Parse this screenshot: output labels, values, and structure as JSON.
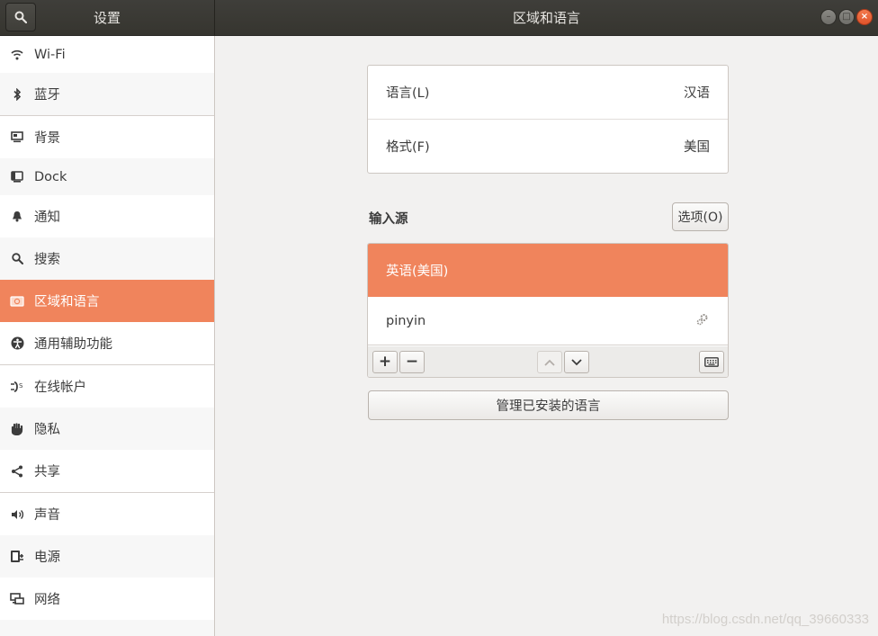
{
  "header": {
    "sidebar_title": "设置",
    "title": "区域和语言",
    "buttons": {
      "minimize": "–",
      "maximize": "□",
      "close": "×"
    }
  },
  "sidebar": {
    "items": [
      {
        "label": "Wi-Fi",
        "icon": "wifi-icon"
      },
      {
        "label": "蓝牙",
        "icon": "bluetooth-icon"
      },
      {
        "label": "背景",
        "icon": "background-icon"
      },
      {
        "label": "Dock",
        "icon": "dock-icon"
      },
      {
        "label": "通知",
        "icon": "bell-icon"
      },
      {
        "label": "搜索",
        "icon": "search-icon"
      },
      {
        "label": "区域和语言",
        "icon": "region-icon",
        "active": true
      },
      {
        "label": "通用辅助功能",
        "icon": "accessibility-icon"
      },
      {
        "label": "在线帐户",
        "icon": "online-accounts-icon"
      },
      {
        "label": "隐私",
        "icon": "hand-icon"
      },
      {
        "label": "共享",
        "icon": "share-icon"
      },
      {
        "label": "声音",
        "icon": "speaker-icon"
      },
      {
        "label": "电源",
        "icon": "power-icon"
      },
      {
        "label": "网络",
        "icon": "network-icon"
      }
    ]
  },
  "main": {
    "language": {
      "label": "语言(L)",
      "value": "汉语"
    },
    "formats": {
      "label": "格式(F)",
      "value": "美国"
    },
    "input_sources": {
      "title": "输入源",
      "options_label": "选项(O)",
      "items": [
        {
          "label": "英语(美国)",
          "selected": true
        },
        {
          "label": "pinyin",
          "icon": "settings-gear-icon"
        }
      ],
      "toolbar": {
        "add": "+",
        "remove": "−"
      }
    },
    "manage_label": "管理已安装的语言"
  },
  "watermark": "https://blog.csdn.net/qq_39660333",
  "colors": {
    "accent": "#f0845c",
    "header": "#3c3b37",
    "background": "#f2f1f0"
  }
}
